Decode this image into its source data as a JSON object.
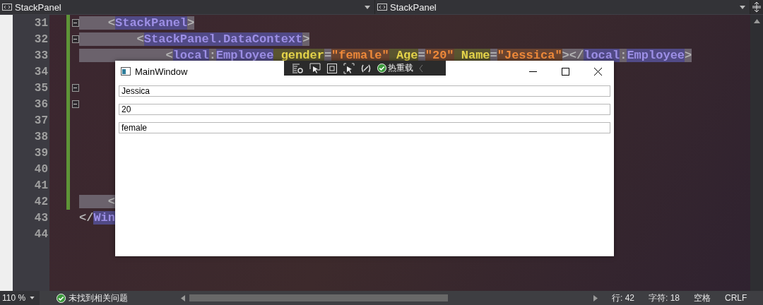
{
  "navigation_bar": {
    "left_dropdown": "StackPanel",
    "right_dropdown": "StackPanel"
  },
  "editor": {
    "lines": [
      {
        "number": "31",
        "changed": true,
        "foldable": true,
        "tokens": [
          {
            "kind": "punct",
            "text": "    <"
          },
          {
            "kind": "tag",
            "text": "StackPanel"
          },
          {
            "kind": "punct",
            "text": ">"
          }
        ]
      },
      {
        "number": "32",
        "changed": true,
        "foldable": true,
        "tokens": [
          {
            "kind": "punct",
            "text": "        <"
          },
          {
            "kind": "tag",
            "text": "StackPanel.DataContext"
          },
          {
            "kind": "punct",
            "text": ">"
          }
        ]
      },
      {
        "number": "33",
        "changed": true,
        "foldable": false,
        "tokens": [
          {
            "kind": "punct",
            "text": "            <"
          },
          {
            "kind": "tag",
            "text": "local"
          },
          {
            "kind": "punct",
            "text": ":"
          },
          {
            "kind": "tag",
            "text": "Employee"
          },
          {
            "kind": "attr",
            "text": " gender"
          },
          {
            "kind": "punct",
            "text": "="
          },
          {
            "kind": "value",
            "text": "\"female\""
          },
          {
            "kind": "attr",
            "text": " Age"
          },
          {
            "kind": "punct",
            "text": "="
          },
          {
            "kind": "value",
            "text": "\"20\""
          },
          {
            "kind": "attr",
            "text": " Name"
          },
          {
            "kind": "punct",
            "text": "="
          },
          {
            "kind": "value",
            "text": "\"Jessica\""
          },
          {
            "kind": "punct",
            "text": "></"
          },
          {
            "kind": "tag",
            "text": "local"
          },
          {
            "kind": "punct",
            "text": ":"
          },
          {
            "kind": "tag",
            "text": "Employee"
          },
          {
            "kind": "punct",
            "text": ">"
          }
        ]
      },
      {
        "number": "34",
        "changed": true,
        "foldable": false
      },
      {
        "number": "35",
        "changed": true,
        "foldable": true
      },
      {
        "number": "36",
        "changed": true,
        "foldable": true
      },
      {
        "number": "37",
        "changed": true,
        "foldable": false
      },
      {
        "number": "38",
        "changed": true,
        "foldable": false
      },
      {
        "number": "39",
        "changed": true,
        "foldable": false
      },
      {
        "number": "40",
        "changed": true,
        "foldable": false
      },
      {
        "number": "41",
        "changed": true,
        "foldable": false
      },
      {
        "number": "42",
        "changed": true,
        "foldable": false,
        "tokens": [
          {
            "kind": "punct",
            "text": "    <"
          }
        ]
      },
      {
        "number": "43",
        "changed": false,
        "foldable": false,
        "tokens": [
          {
            "kind": "punct",
            "text": "</"
          },
          {
            "kind": "tag",
            "text": "Win"
          }
        ]
      },
      {
        "number": "44",
        "changed": false,
        "foldable": false
      }
    ]
  },
  "app_window": {
    "title": "MainWindow",
    "hot_reload": {
      "label": "热重载"
    },
    "text_boxes": [
      {
        "value": "Jessica"
      },
      {
        "value": "20"
      },
      {
        "value": "female"
      }
    ]
  },
  "status_bar": {
    "zoom": "110 %",
    "issues": "未找到相关问题",
    "line": "行: 42",
    "column": "字符: 18",
    "whitespace": "空格",
    "line_ending": "CRLF"
  }
}
